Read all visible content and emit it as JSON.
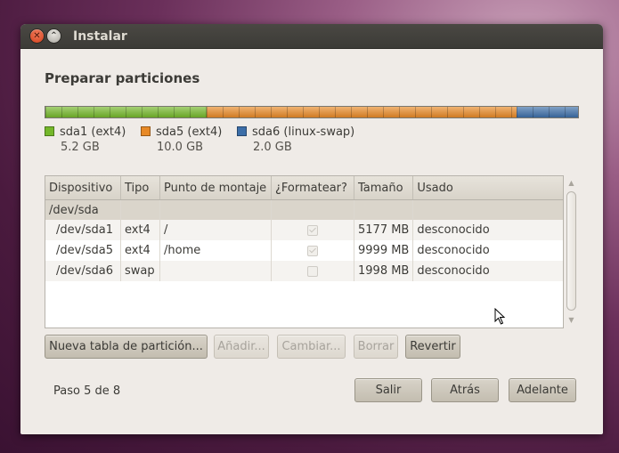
{
  "window": {
    "title": "Instalar"
  },
  "heading": "Preparar particiones",
  "colors": {
    "ext4_root": "#74b72a",
    "ext4_home": "#e78926",
    "swap": "#3c6ea8"
  },
  "partition_bar": [
    {
      "name": "sda1 (ext4)",
      "size": "5.2 GB",
      "fraction": 0.302,
      "color": "#74b72a"
    },
    {
      "name": "sda5 (ext4)",
      "size": "10.0 GB",
      "fraction": 0.582,
      "color": "#e78926"
    },
    {
      "name": "sda6 (linux-swap)",
      "size": "2.0 GB",
      "fraction": 0.116,
      "color": "#3c6ea8"
    }
  ],
  "table": {
    "columns": [
      "Dispositivo",
      "Tipo",
      "Punto de montaje",
      "¿Formatear?",
      "Tamaño",
      "Usado"
    ],
    "group": "/dev/sda",
    "rows": [
      {
        "device": "/dev/sda1",
        "type": "ext4",
        "mount": "/",
        "format": true,
        "size": "5177 MB",
        "used": "desconocido"
      },
      {
        "device": "/dev/sda5",
        "type": "ext4",
        "mount": "/home",
        "format": true,
        "size": "9999 MB",
        "used": "desconocido"
      },
      {
        "device": "/dev/sda6",
        "type": "swap",
        "mount": "",
        "format": false,
        "size": "1998 MB",
        "used": "desconocido"
      }
    ]
  },
  "actions": {
    "new_table": "Nueva tabla de partición...",
    "add": "Añadir...",
    "change": "Cambiar...",
    "delete": "Borrar",
    "revert": "Revertir"
  },
  "footer": {
    "step": "Paso 5 de 8",
    "quit": "Salir",
    "back": "Atrás",
    "forward": "Adelante"
  }
}
